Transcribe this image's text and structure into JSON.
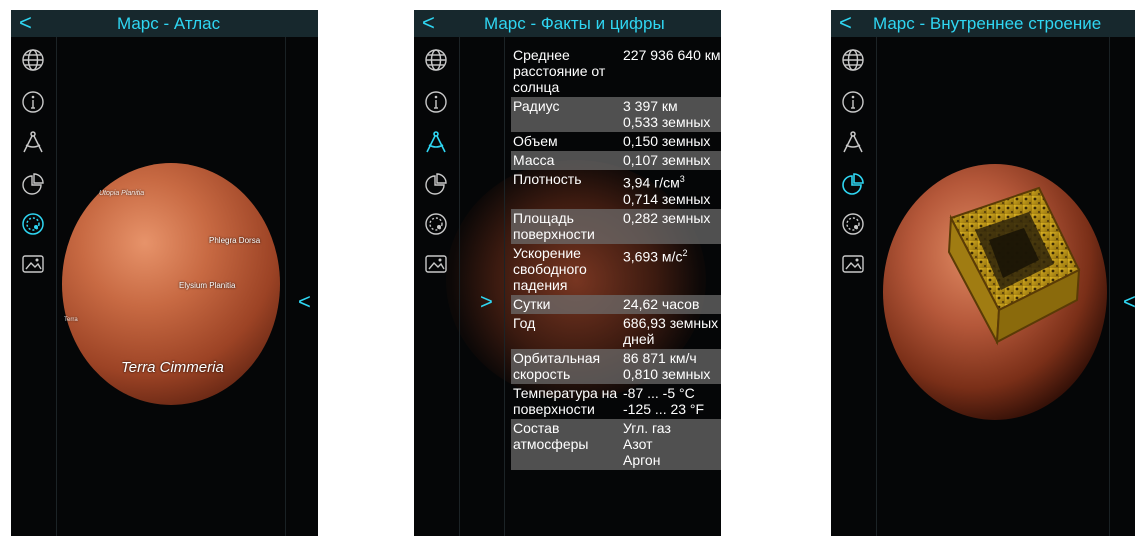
{
  "screens": [
    {
      "title": "Марс - Атлас",
      "back_glyph": "<",
      "open_glyph": "<",
      "icons": [
        "globe-icon",
        "info-icon",
        "compass-icon",
        "pie-chart-icon",
        "planet-layers-icon",
        "image-icon"
      ],
      "active_icon": "planet-layers-icon",
      "map_labels": {
        "l1": "Utopia Planitia",
        "l2": "Phlegra Dorsa",
        "l3": "Elysium Planitia",
        "l4": "Terra Cimmeria",
        "l5": "Terra"
      }
    },
    {
      "title": "Марс - Факты и цифры",
      "back_glyph": "<",
      "open_glyph": ">",
      "icons": [
        "globe-icon",
        "info-icon",
        "compass-icon",
        "pie-chart-icon",
        "planet-layers-icon",
        "image-icon"
      ],
      "active_icon": "compass-icon",
      "facts": [
        {
          "label": "Среднее расстояние от солнца",
          "value": "227 936 640 км"
        },
        {
          "label": "Радиус",
          "value": "3 397 км",
          "value2": "0,533 земных"
        },
        {
          "label": "Объем",
          "value": "0,150 земных"
        },
        {
          "label": "Масса",
          "value": "0,107 земных"
        },
        {
          "label": "Плотность",
          "value": "3,94 г/см",
          "value_sup": "3",
          "value2": "0,714 земных"
        },
        {
          "label": "Площадь поверхности",
          "value": "0,282 земных"
        },
        {
          "label": "Ускорение свободного падения",
          "value": "3,693 м/с",
          "value_sup": "2"
        },
        {
          "label": "Сутки",
          "value": "24,62 часов"
        },
        {
          "label": "Год",
          "value": "686,93 земных дней"
        },
        {
          "label": "Орбитальная скорость",
          "value": "86 871 км/ч",
          "value2": "0,810 земных"
        },
        {
          "label": "Температура на поверхности",
          "value": "-87 ... -5 °C",
          "value2": "-125 ... 23 °F"
        },
        {
          "label": "Состав атмосферы",
          "value": "Угл. газ",
          "value2": "Азот",
          "value3": "Аргон"
        }
      ]
    },
    {
      "title": "Марс - Внутреннее строение",
      "back_glyph": "<",
      "open_glyph": "<",
      "icons": [
        "globe-icon",
        "info-icon",
        "compass-icon",
        "pie-chart-icon",
        "planet-layers-icon",
        "image-icon"
      ],
      "active_icon": "pie-chart-icon"
    }
  ],
  "colors": {
    "accent": "#2fd6f2",
    "titlebar": "#17282d",
    "background": "#050607",
    "icon_inactive": "#c9c9c9",
    "row_highlight": "#6e6e6e",
    "mars": "#b5583a",
    "core": "#c9a21a"
  }
}
